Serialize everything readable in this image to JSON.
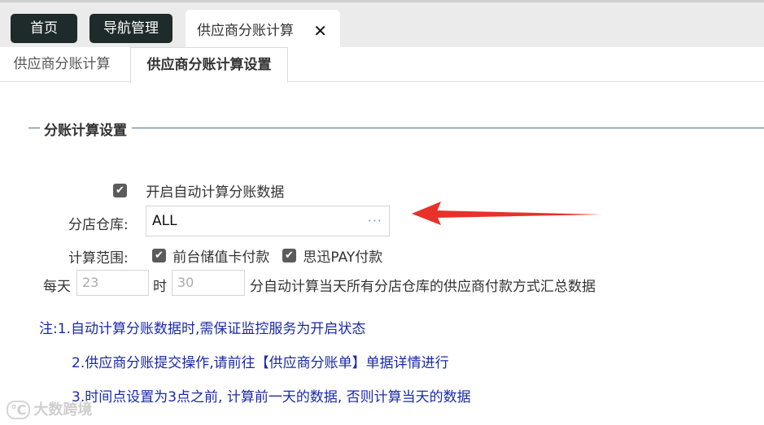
{
  "tabs": {
    "home": "首页",
    "nav": "导航管理",
    "current": "供应商分账计算",
    "close": "✕"
  },
  "subtabs": [
    "供应商分账计算",
    "供应商分账计算设置"
  ],
  "section_title": "分账计算设置",
  "auto_calc": {
    "checked": true,
    "label": "开启自动计算分账数据"
  },
  "warehouse": {
    "label": "分店仓库:",
    "value": "ALL",
    "more": "···"
  },
  "scope": {
    "label": "计算范围:",
    "options": [
      {
        "checked": true,
        "label": "前台储值卡付款"
      },
      {
        "checked": true,
        "label": "思迅PAY付款"
      }
    ]
  },
  "schedule": {
    "prefix": "每天",
    "hour": "23",
    "mid": "时",
    "minute": "30",
    "suffix": "分自动计算当天所有分店仓库的供应商付款方式汇总数据"
  },
  "notes": [
    "注:1.自动计算分账数据时,需保证监控服务为开启状态",
    "2.供应商分账提交操作,请前往【供应商分账单】单据详情进行",
    "3.时间点设置为3点之前, 计算前一天的数据, 否则计算当天的数据"
  ],
  "watermark": "大数跨境",
  "colors": {
    "note": "#1a2aa8",
    "arrow": "#e8312a",
    "dark_tab": "#1f2a2a"
  }
}
